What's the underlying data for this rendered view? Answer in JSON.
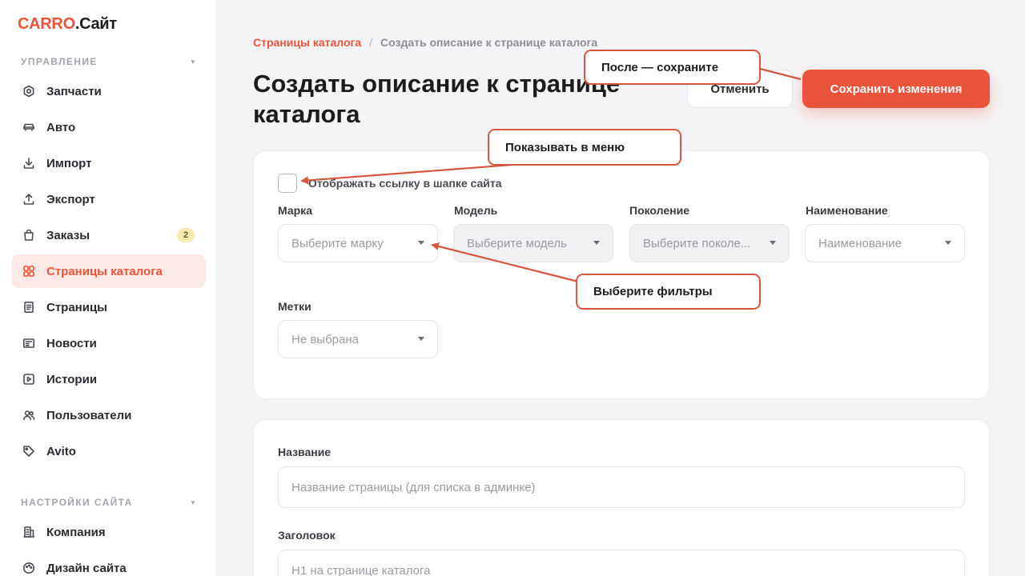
{
  "brand": {
    "accent": "CARRO",
    "rest": ".Сайт"
  },
  "colors": {
    "accent": "#e9553b",
    "annotation": "#d6573f"
  },
  "sidebar": {
    "sections": [
      {
        "title": "УПРАВЛЕНИЕ"
      },
      {
        "title": "НАСТРОЙКИ САЙТА"
      }
    ],
    "items": [
      {
        "label": "Запчасти",
        "icon": "gear-icon"
      },
      {
        "label": "Авто",
        "icon": "car-icon"
      },
      {
        "label": "Импорт",
        "icon": "download-icon"
      },
      {
        "label": "Экспорт",
        "icon": "upload-icon"
      },
      {
        "label": "Заказы",
        "icon": "bag-icon",
        "badge": "2"
      },
      {
        "label": "Страницы каталога",
        "icon": "grid-icon",
        "active": true
      },
      {
        "label": "Страницы",
        "icon": "document-icon"
      },
      {
        "label": "Новости",
        "icon": "news-icon"
      },
      {
        "label": "Истории",
        "icon": "play-icon"
      },
      {
        "label": "Пользователи",
        "icon": "users-icon"
      },
      {
        "label": "Avito",
        "icon": "tag-icon"
      },
      {
        "label": "Компания",
        "icon": "building-icon"
      },
      {
        "label": "Дизайн сайта",
        "icon": "palette-icon"
      }
    ]
  },
  "breadcrumb": {
    "parent": "Страницы каталога",
    "separator": "/",
    "current": "Создать описание к странице каталога"
  },
  "page": {
    "title": "Создать описание к странице каталога"
  },
  "actions": {
    "cancel": "Отменить",
    "save": "Сохранить изменения"
  },
  "form": {
    "show_in_header_label": "Отображать ссылку в шапке сайта",
    "show_in_header_checked": false,
    "filters": [
      {
        "label": "Марка",
        "placeholder": "Выберите марку",
        "disabled": false
      },
      {
        "label": "Модель",
        "placeholder": "Выберите модель",
        "disabled": true
      },
      {
        "label": "Поколение",
        "placeholder": "Выберите поколе...",
        "disabled": true
      },
      {
        "label": "Наименование",
        "placeholder": "Наименование",
        "disabled": false
      }
    ],
    "tags": {
      "label": "Метки",
      "value": "Не выбрана"
    },
    "name": {
      "label": "Название",
      "placeholder": "Название страницы (для списка в админке)"
    },
    "heading": {
      "label": "Заголовок",
      "placeholder": "H1 на странице каталога"
    }
  },
  "annotations": {
    "save_hint": "После — сохраните",
    "menu_hint": "Показывать в меню",
    "filters_hint": "Выберите фильтры"
  }
}
